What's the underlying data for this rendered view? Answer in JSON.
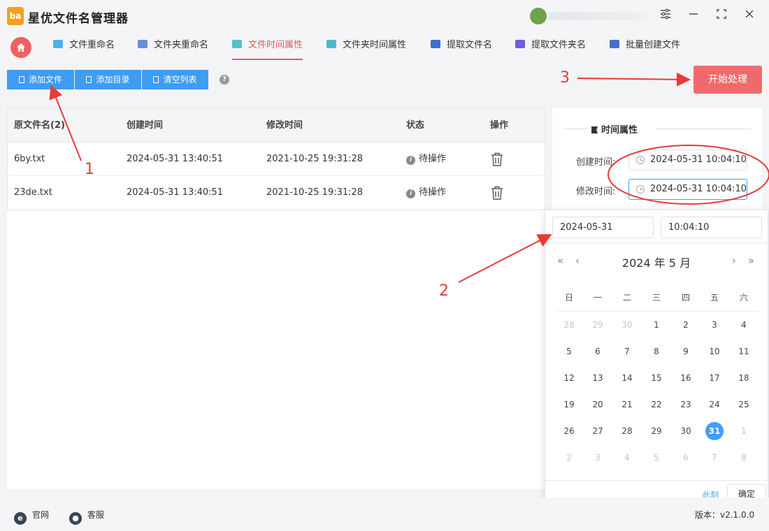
{
  "app": {
    "title": "星优文件名管理器",
    "logo_text": "ba"
  },
  "window_controls": {
    "settings": "⚙",
    "minimize": "—",
    "maximize": "⛶",
    "close": "✕"
  },
  "nav": {
    "tabs": [
      {
        "label": "文件重命名",
        "color": "#4fb2e6"
      },
      {
        "label": "文件夹重命名",
        "color": "#6a8fd6"
      },
      {
        "label": "文件时间属性",
        "color": "#5bc0c6"
      },
      {
        "label": "文件夹时间属性",
        "color": "#4bb8c8"
      },
      {
        "label": "提取文件名",
        "color": "#3a6fd1"
      },
      {
        "label": "提取文件夹名",
        "color": "#6d5fd6"
      },
      {
        "label": "批量创建文件",
        "color": "#4a6fc9"
      }
    ],
    "active_index": 2
  },
  "toolbar": {
    "add_file": "添加文件",
    "add_dir": "添加目录",
    "clear_list": "清空列表",
    "help": "?",
    "start": "开始处理"
  },
  "table": {
    "headers": [
      "原文件名(2)",
      "创建时间",
      "修改时间",
      "状态",
      "操作"
    ],
    "rows": [
      {
        "name": "6by.txt",
        "created": "2024-05-31 13:40:51",
        "modified": "2021-10-25 19:31:28",
        "status": "待操作"
      },
      {
        "name": "23de.txt",
        "created": "2024-05-31 13:40:51",
        "modified": "2021-10-25 19:31:28",
        "status": "待操作"
      }
    ]
  },
  "props": {
    "title": "时间属性",
    "created_label": "创建时间:",
    "created_value": "2024-05-31 10:04:10",
    "modified_label": "修改时间:",
    "modified_value": "2024-05-31 10:04:10"
  },
  "picker": {
    "date_value": "2024-05-31",
    "time_value": "10:04:10",
    "header": "2024 年  5 月",
    "weekdays": [
      "日",
      "一",
      "二",
      "三",
      "四",
      "五",
      "六"
    ],
    "weeks": [
      [
        "28",
        "29",
        "30",
        "1",
        "2",
        "3",
        "4"
      ],
      [
        "5",
        "6",
        "7",
        "8",
        "9",
        "10",
        "11"
      ],
      [
        "12",
        "13",
        "14",
        "15",
        "16",
        "17",
        "18"
      ],
      [
        "19",
        "20",
        "21",
        "22",
        "23",
        "24",
        "25"
      ],
      [
        "26",
        "27",
        "28",
        "29",
        "30",
        "31",
        "1"
      ],
      [
        "2",
        "3",
        "4",
        "5",
        "6",
        "7",
        "8"
      ]
    ],
    "selected": "31",
    "now_label": "此刻",
    "ok_label": "确定"
  },
  "footer": {
    "website": "官网",
    "support": "客服",
    "version": "版本：v2.1.0.0"
  },
  "annotations": {
    "n1": "1",
    "n2": "2",
    "n3": "3"
  },
  "colors": {
    "accent_red": "#ef6b6b",
    "primary_blue": "#3f9cf3",
    "annotation_red": "#e83a3a"
  }
}
